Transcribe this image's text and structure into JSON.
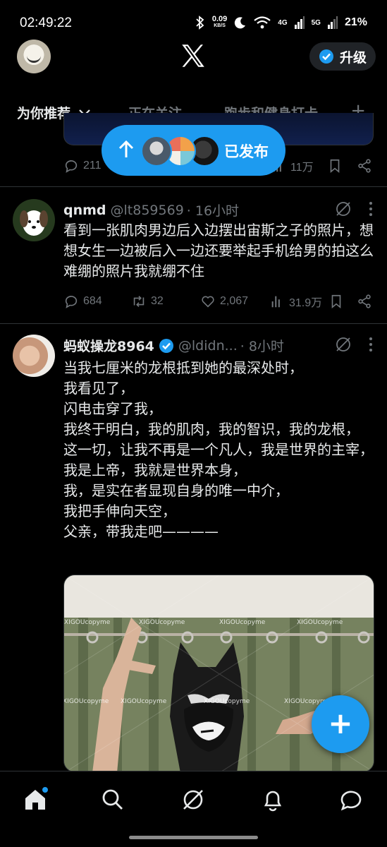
{
  "status_bar": {
    "time": "02:49:22",
    "net_speed_value": "0.09",
    "net_speed_unit": "KB/S",
    "network_4g": "4G",
    "network_5g": "5G",
    "battery": "21%"
  },
  "header": {
    "upgrade_label": "升级"
  },
  "tabs": [
    {
      "label": "为你推荐"
    },
    {
      "label": "正在关注"
    },
    {
      "label": "跑步和健身打卡"
    }
  ],
  "prev_tweet": {
    "replies": "211",
    "views": "11万"
  },
  "toast": {
    "label": "已发布"
  },
  "tweets": [
    {
      "name": "qnmd",
      "handle": "@lt859569",
      "time": "· 16小时",
      "text": "看到一张肌肉男边后入边摆出宙斯之子的照片，想想女生一边被后入一边还要举起手机给男的拍这么难绷的照片我就绷不住",
      "replies": "684",
      "retweets": "32",
      "likes": "2,067",
      "views": "31.9万"
    },
    {
      "name": "蚂蚁操龙8964",
      "handle": "@ldidn...",
      "time": "· 8小时",
      "text": "当我七厘米的龙根抵到她的最深处时，\n我看见了，\n闪电击穿了我，\n我终于明白，我的肌肉，我的智识，我的龙根，\n这一切，让我不再是一个凡人，我是世界的主宰，我是上帝，我就是世界本身，\n我，是实在者显现自身的唯一中介，\n我把手伸向天空，\n父亲，带我走吧————",
      "watermark": "XIGOUcopyme"
    }
  ],
  "colors": {
    "accent": "#1d9bf0",
    "background": "#000000",
    "muted": "#71767b"
  }
}
